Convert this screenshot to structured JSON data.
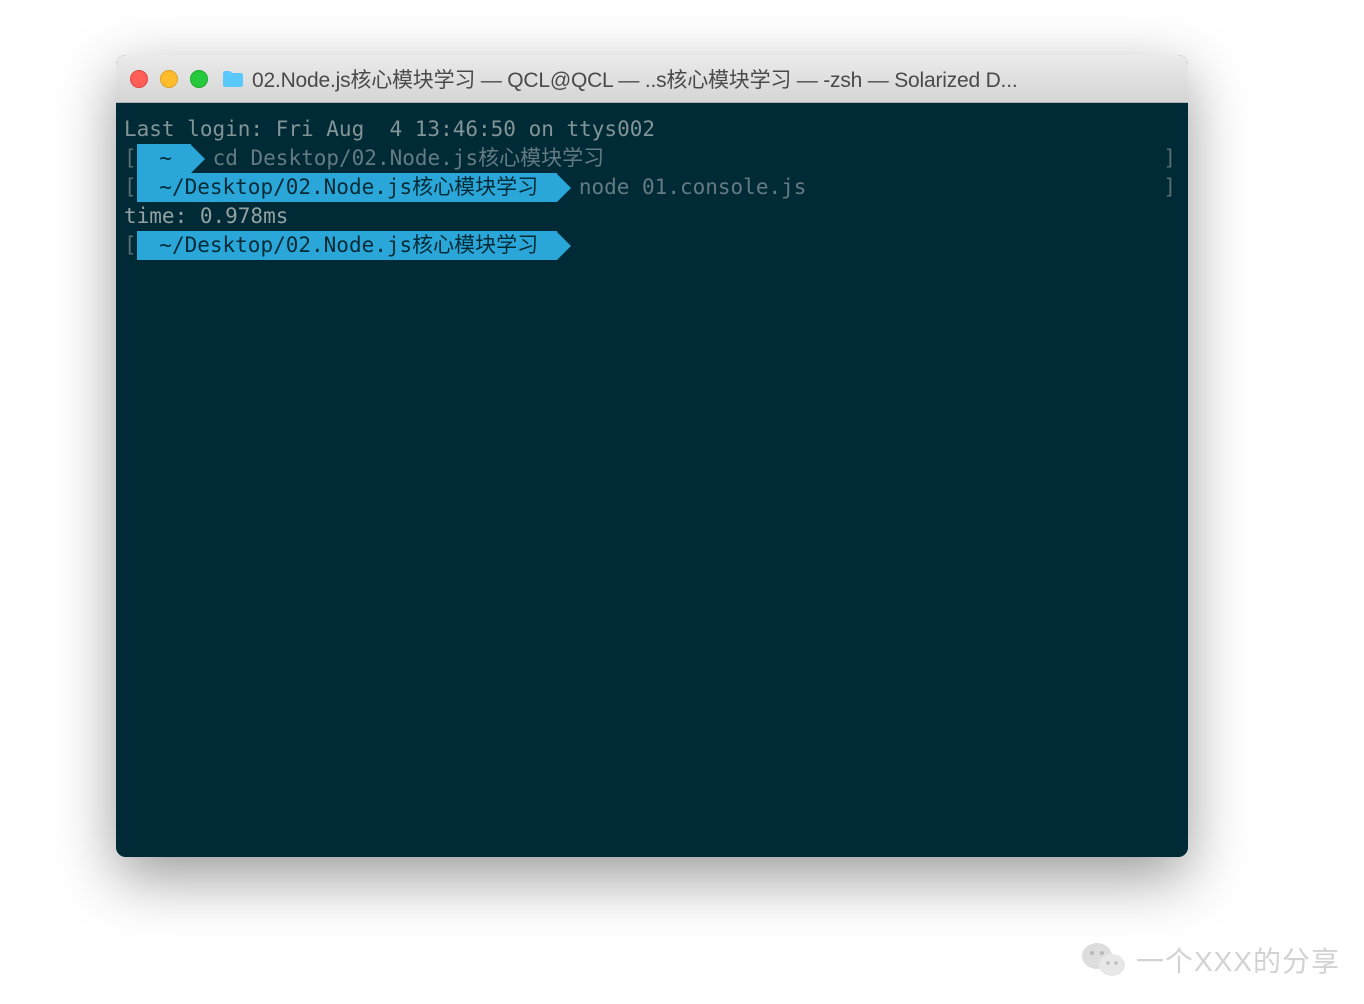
{
  "window": {
    "title": "02.Node.js核心模块学习 — QCL@QCL — ..s核心模块学习 — -zsh — Solarized D..."
  },
  "terminal": {
    "last_login": "Last login: Fri Aug  4 13:46:50 on ttys002",
    "lines": [
      {
        "bracket_left": "[",
        "prompt": " ~ ",
        "command": "cd Desktop/02.Node.js核心模块学习",
        "bracket_right": "]"
      },
      {
        "bracket_left": "[",
        "prompt": " ~/Desktop/02.Node.js核心模块学习 ",
        "command": "node 01.console.js",
        "bracket_right": "]"
      }
    ],
    "output": "time: 0.978ms",
    "current_prompt": {
      "bracket_left": "[",
      "prompt": " ~/Desktop/02.Node.js核心模块学习 "
    }
  },
  "watermark": {
    "text": "一个XXX的分享"
  }
}
